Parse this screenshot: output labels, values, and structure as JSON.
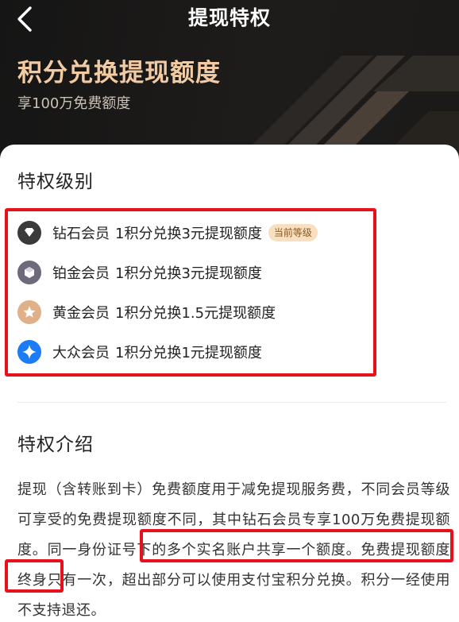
{
  "nav": {
    "back_icon": "chevron-left-icon",
    "title": "提现特权"
  },
  "hero": {
    "title": "积分兑换提现额度",
    "subtitle": "享100万免费额度"
  },
  "levels": {
    "title": "特权级别",
    "items": [
      {
        "icon": "diamond-icon",
        "name": "钻石会员",
        "rate": "1积分兑换3元提现额度",
        "badge": "当前等级",
        "color": "#3a3a3a"
      },
      {
        "icon": "platinum-icon",
        "name": "铂金会员",
        "rate": "1积分兑换3元提现额度",
        "color": "#6f6a7b"
      },
      {
        "icon": "gold-star-icon",
        "name": "黄金会员",
        "rate": "1积分兑换1.5元提现额度",
        "color": "#e0b089"
      },
      {
        "icon": "sparkle-icon",
        "name": "大众会员",
        "rate": "1积分兑换1元提现额度",
        "color": "#1b7cf5"
      }
    ]
  },
  "intro": {
    "title": "特权介绍",
    "part1": "提现（含转账到卡）免费额度用于减免提现服务费，不同会员等级可享受的免费提现额度不同，其中钻石会员专享100万免费提现额度。",
    "part2": "同一身份证号下的多个实名账户共享一个额度。",
    "part3": "免费提现额度终身只有一次，超出部分可以使用支付宝积分兑换。积分一经使用不支持退还。"
  },
  "colors": {
    "hero_bg": "#1b1b1b",
    "hero_title": "#f3cba3",
    "highlight_box": "#e8101c",
    "badge_bg": "#f7dfbf"
  }
}
